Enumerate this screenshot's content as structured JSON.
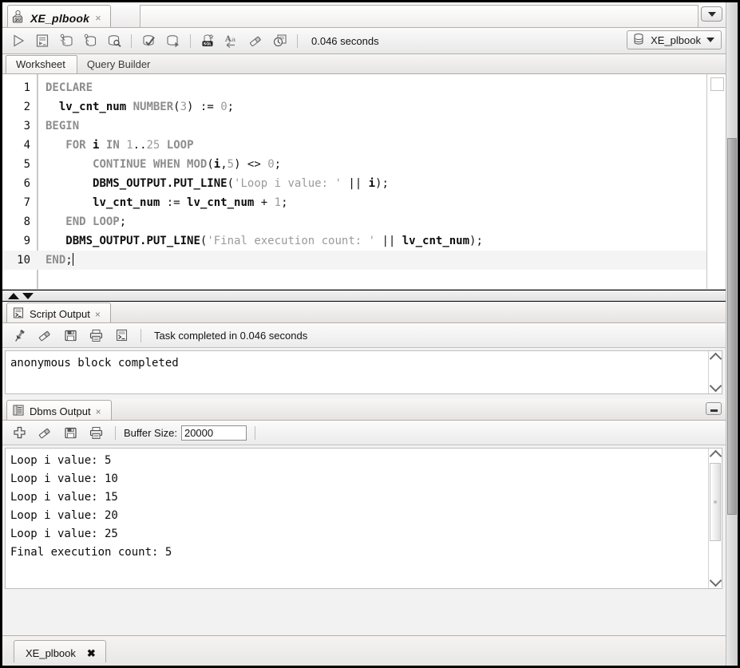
{
  "window": {
    "worksheet_tab": {
      "title": "XE_plbook",
      "icon": "sql-connection-icon",
      "close": "×"
    },
    "tabstrip_dropdown_icon": "chevron-down-icon"
  },
  "toolbar": {
    "buttons": [
      {
        "name": "run-statement-button",
        "icon": "play-triangle-icon"
      },
      {
        "name": "run-script-button",
        "icon": "script-run-icon"
      },
      {
        "name": "explain-plan-button",
        "icon": "explain-plan-icon"
      },
      {
        "name": "autotrace-button",
        "icon": "autotrace-icon"
      },
      {
        "name": "sql-history-query-button",
        "icon": "db-search-icon"
      },
      {
        "name": "commit-button",
        "icon": "commit-check-icon"
      },
      {
        "name": "rollback-button",
        "icon": "rollback-icon"
      },
      {
        "name": "unshared-sql-worksheet-button",
        "icon": "new-sql-worksheet-icon"
      },
      {
        "name": "to-upper-lower-button",
        "icon": "change-case-icon"
      },
      {
        "name": "clear-button",
        "icon": "eraser-icon"
      },
      {
        "name": "sql-history-button",
        "icon": "history-clock-icon"
      }
    ],
    "timing": "0.046 seconds",
    "connection": {
      "name": "XE_plbook",
      "icon": "database-icon",
      "caret_icon": "chevron-down-icon"
    }
  },
  "subtabs": [
    {
      "label": "Worksheet",
      "active": true
    },
    {
      "label": "Query Builder",
      "active": false
    }
  ],
  "editor": {
    "lines": [
      {
        "n": "1",
        "segments": [
          {
            "t": "DECLARE",
            "c": "kw"
          }
        ]
      },
      {
        "n": "2",
        "segments": [
          {
            "t": "  ",
            "c": "plain"
          },
          {
            "t": "lv_cnt_num",
            "c": "ident"
          },
          {
            "t": " ",
            "c": "plain"
          },
          {
            "t": "NUMBER",
            "c": "kw"
          },
          {
            "t": "(",
            "c": "plain"
          },
          {
            "t": "3",
            "c": "num"
          },
          {
            "t": ") := ",
            "c": "plain"
          },
          {
            "t": "0",
            "c": "num"
          },
          {
            "t": ";",
            "c": "plain"
          }
        ]
      },
      {
        "n": "3",
        "segments": [
          {
            "t": "BEGIN",
            "c": "kw"
          }
        ]
      },
      {
        "n": "4",
        "segments": [
          {
            "t": "   ",
            "c": "plain"
          },
          {
            "t": "FOR",
            "c": "kw"
          },
          {
            "t": " ",
            "c": "plain"
          },
          {
            "t": "i",
            "c": "ident"
          },
          {
            "t": " ",
            "c": "plain"
          },
          {
            "t": "IN",
            "c": "kw"
          },
          {
            "t": " ",
            "c": "plain"
          },
          {
            "t": "1",
            "c": "num"
          },
          {
            "t": "..",
            "c": "plain"
          },
          {
            "t": "25",
            "c": "num"
          },
          {
            "t": " ",
            "c": "plain"
          },
          {
            "t": "LOOP",
            "c": "kw"
          }
        ]
      },
      {
        "n": "5",
        "segments": [
          {
            "t": "       ",
            "c": "plain"
          },
          {
            "t": "CONTINUE WHEN MOD",
            "c": "kw"
          },
          {
            "t": "(",
            "c": "plain"
          },
          {
            "t": "i",
            "c": "ident"
          },
          {
            "t": ",",
            "c": "plain"
          },
          {
            "t": "5",
            "c": "num"
          },
          {
            "t": ") <> ",
            "c": "plain"
          },
          {
            "t": "0",
            "c": "num"
          },
          {
            "t": ";",
            "c": "plain"
          }
        ]
      },
      {
        "n": "6",
        "segments": [
          {
            "t": "       ",
            "c": "plain"
          },
          {
            "t": "DBMS_OUTPUT.PUT_LINE",
            "c": "ident"
          },
          {
            "t": "(",
            "c": "plain"
          },
          {
            "t": "'Loop i value: '",
            "c": "str"
          },
          {
            "t": " || ",
            "c": "plain"
          },
          {
            "t": "i",
            "c": "ident"
          },
          {
            "t": ");",
            "c": "plain"
          }
        ]
      },
      {
        "n": "7",
        "segments": [
          {
            "t": "       ",
            "c": "plain"
          },
          {
            "t": "lv_cnt_num",
            "c": "ident"
          },
          {
            "t": " := ",
            "c": "plain"
          },
          {
            "t": "lv_cnt_num",
            "c": "ident"
          },
          {
            "t": " + ",
            "c": "plain"
          },
          {
            "t": "1",
            "c": "num"
          },
          {
            "t": ";",
            "c": "plain"
          }
        ]
      },
      {
        "n": "8",
        "segments": [
          {
            "t": "   ",
            "c": "plain"
          },
          {
            "t": "END LOOP",
            "c": "kw"
          },
          {
            "t": ";",
            "c": "plain"
          }
        ]
      },
      {
        "n": "9",
        "segments": [
          {
            "t": "   ",
            "c": "plain"
          },
          {
            "t": "DBMS_OUTPUT.PUT_LINE",
            "c": "ident"
          },
          {
            "t": "(",
            "c": "plain"
          },
          {
            "t": "'Final execution count: '",
            "c": "str"
          },
          {
            "t": " || ",
            "c": "plain"
          },
          {
            "t": "lv_cnt_num",
            "c": "ident"
          },
          {
            "t": ");",
            "c": "plain"
          }
        ]
      },
      {
        "n": "10",
        "segments": [
          {
            "t": "END",
            "c": "kw"
          },
          {
            "t": ";",
            "c": "plain"
          }
        ],
        "current": true
      }
    ]
  },
  "script_output": {
    "tab_label": "Script Output",
    "tab_icon": "script-output-icon",
    "tab_close": "×",
    "buttons": [
      {
        "name": "pin-button",
        "icon": "pin-icon"
      },
      {
        "name": "clear-button",
        "icon": "eraser-icon"
      },
      {
        "name": "save-button",
        "icon": "floppy-save-icon"
      },
      {
        "name": "print-button",
        "icon": "printer-icon"
      },
      {
        "name": "open-in-editor-button",
        "icon": "script-output-icon"
      }
    ],
    "status": "Task completed in 0.046 seconds",
    "content": "anonymous block completed"
  },
  "dbms_output": {
    "tab_label": "Dbms Output",
    "tab_icon": "dbms-output-icon",
    "tab_close": "×",
    "minimize_icon": "minimize-icon",
    "buttons": [
      {
        "name": "enable-dbms-output-button",
        "icon": "plus-icon"
      },
      {
        "name": "clear-button",
        "icon": "eraser-icon"
      },
      {
        "name": "save-button",
        "icon": "floppy-save-icon"
      },
      {
        "name": "print-button",
        "icon": "printer-icon"
      }
    ],
    "buffer_label": "Buffer Size:",
    "buffer_value": "20000",
    "lines": [
      "Loop i value: 5",
      "Loop i value: 10",
      "Loop i value: 15",
      "Loop i value: 20",
      "Loop i value: 25",
      "Final execution count: 5"
    ]
  },
  "status_tab": {
    "label": "XE_plbook",
    "close": "✖"
  }
}
